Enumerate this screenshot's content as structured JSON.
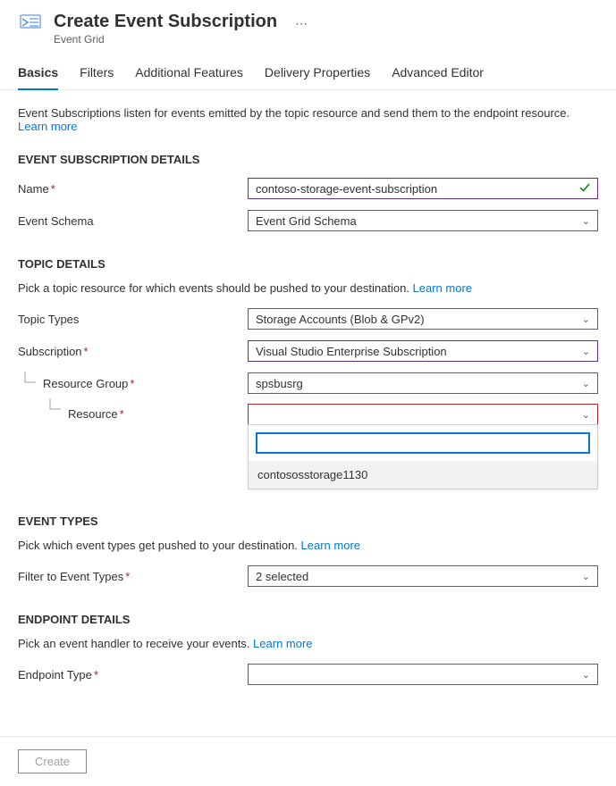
{
  "header": {
    "title": "Create Event Subscription",
    "subtitle": "Event Grid",
    "more": "⋯"
  },
  "tabs": [
    {
      "label": "Basics",
      "active": true
    },
    {
      "label": "Filters",
      "active": false
    },
    {
      "label": "Additional Features",
      "active": false
    },
    {
      "label": "Delivery Properties",
      "active": false
    },
    {
      "label": "Advanced Editor",
      "active": false
    }
  ],
  "intro": {
    "text": "Event Subscriptions listen for events emitted by the topic resource and send them to the endpoint resource. ",
    "link": "Learn more"
  },
  "subscription_details": {
    "title": "EVENT SUBSCRIPTION DETAILS",
    "name_label": "Name",
    "name_value": "contoso-storage-event-subscription",
    "schema_label": "Event Schema",
    "schema_value": "Event Grid Schema"
  },
  "topic_details": {
    "title": "TOPIC DETAILS",
    "desc_text": "Pick a topic resource for which events should be pushed to your destination. ",
    "desc_link": "Learn more",
    "topic_types_label": "Topic Types",
    "topic_types_value": "Storage Accounts (Blob & GPv2)",
    "subscription_label": "Subscription",
    "subscription_value": "Visual Studio Enterprise Subscription",
    "rg_label": "Resource Group",
    "rg_value": "spsbusrg",
    "resource_label": "Resource",
    "resource_value": "",
    "search_value": "",
    "option1": "contososstorage1130"
  },
  "event_types": {
    "title": "EVENT TYPES",
    "desc_text": "Pick which event types get pushed to your destination. ",
    "desc_link": "Learn more",
    "filter_label": "Filter to Event Types",
    "filter_value": "2 selected"
  },
  "endpoint": {
    "title": "ENDPOINT DETAILS",
    "desc_text": "Pick an event handler to receive your events. ",
    "desc_link": "Learn more",
    "type_label": "Endpoint Type",
    "type_value": ""
  },
  "footer": {
    "create": "Create"
  }
}
